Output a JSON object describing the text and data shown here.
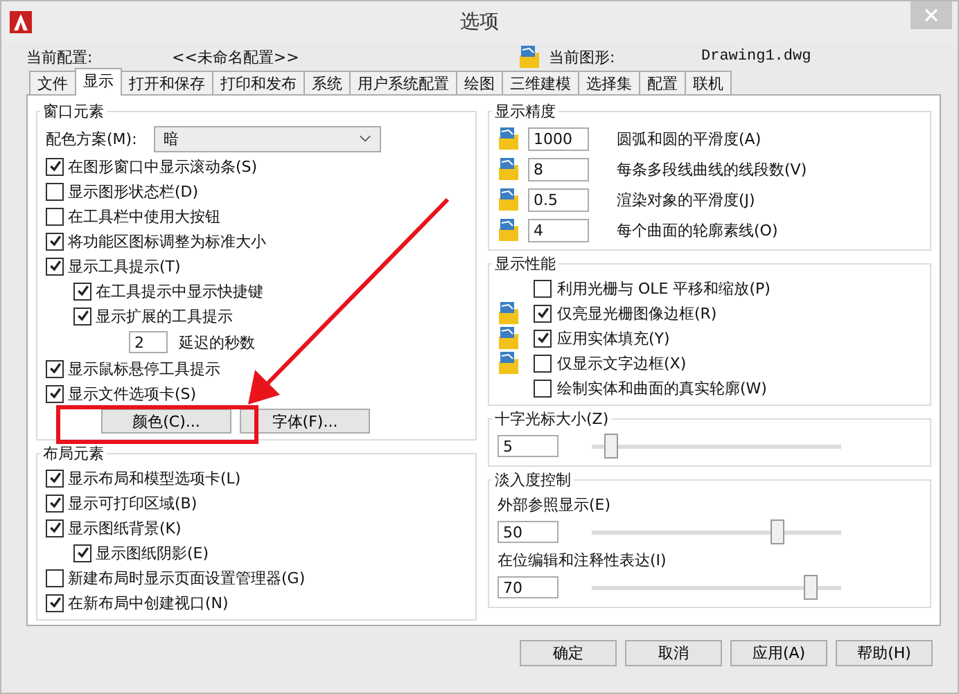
{
  "window": {
    "title": "选项"
  },
  "profile": {
    "label": "当前配置:",
    "value": "<<未命名配置>>",
    "drawing_label": "当前图形:",
    "drawing_value": "Drawing1.dwg"
  },
  "tabs": [
    {
      "label": "文件",
      "selected": false
    },
    {
      "label": "显示",
      "selected": true
    },
    {
      "label": "打开和保存",
      "selected": false
    },
    {
      "label": "打印和发布",
      "selected": false
    },
    {
      "label": "系统",
      "selected": false
    },
    {
      "label": "用户系统配置",
      "selected": false
    },
    {
      "label": "绘图",
      "selected": false
    },
    {
      "label": "三维建模",
      "selected": false
    },
    {
      "label": "选择集",
      "selected": false
    },
    {
      "label": "配置",
      "selected": false
    },
    {
      "label": "联机",
      "selected": false
    }
  ],
  "window_elements": {
    "title": "窗口元素",
    "color_scheme": {
      "label": "配色方案(M):",
      "value": "暗"
    },
    "items": [
      {
        "kind": "checkbox",
        "label": "在图形窗口中显示滚动条(S)",
        "checked": true
      },
      {
        "kind": "checkbox",
        "label": "显示图形状态栏(D)",
        "checked": false
      },
      {
        "kind": "checkbox",
        "label": "在工具栏中使用大按钮",
        "checked": false
      },
      {
        "kind": "checkbox",
        "label": "将功能区图标调整为标准大小",
        "checked": true
      },
      {
        "kind": "checkbox",
        "label": "显示工具提示(T)",
        "checked": true,
        "children": [
          {
            "kind": "checkbox",
            "label": "在工具提示中显示快捷键",
            "checked": true
          },
          {
            "kind": "checkbox",
            "label": "显示扩展的工具提示",
            "checked": true,
            "children": [
              {
                "kind": "number",
                "value": "2",
                "label": "延迟的秒数"
              }
            ]
          }
        ]
      },
      {
        "kind": "checkbox",
        "label": "显示鼠标悬停工具提示",
        "checked": true
      },
      {
        "kind": "checkbox",
        "label": "显示文件选项卡(S)",
        "checked": true
      }
    ],
    "buttons": [
      "颜色(C)...",
      "字体(F)..."
    ]
  },
  "layout_elements": {
    "title": "布局元素",
    "items": [
      {
        "kind": "checkbox",
        "label": "显示布局和模型选项卡(L)",
        "checked": true
      },
      {
        "kind": "checkbox",
        "label": "显示可打印区域(B)",
        "checked": true
      },
      {
        "kind": "checkbox",
        "label": "显示图纸背景(K)",
        "checked": true,
        "children": [
          {
            "kind": "checkbox",
            "label": "显示图纸阴影(E)",
            "checked": true
          }
        ]
      },
      {
        "kind": "checkbox",
        "label": "新建布局时显示页面设置管理器(G)",
        "checked": false
      },
      {
        "kind": "checkbox",
        "label": "在新布局中创建视口(N)",
        "checked": true
      }
    ]
  },
  "display_resolution": {
    "title": "显示精度",
    "rows": [
      {
        "value": "1000",
        "label": "圆弧和圆的平滑度(A)"
      },
      {
        "value": "8",
        "label": "每条多段线曲线的线段数(V)"
      },
      {
        "value": "0.5",
        "label": "渲染对象的平滑度(J)"
      },
      {
        "value": "4",
        "label": "每个曲面的轮廓素线(O)"
      }
    ]
  },
  "display_performance": {
    "title": "显示性能",
    "items": [
      {
        "label": "利用光栅与 OLE 平移和缩放(P)",
        "checked": false,
        "drawing_icon": false
      },
      {
        "label": "仅亮显光栅图像边框(R)",
        "checked": true,
        "drawing_icon": true
      },
      {
        "label": "应用实体填充(Y)",
        "checked": true,
        "drawing_icon": true
      },
      {
        "label": "仅显示文字边框(X)",
        "checked": false,
        "drawing_icon": true
      },
      {
        "label": "绘制实体和曲面的真实轮廓(W)",
        "checked": false,
        "drawing_icon": false
      }
    ]
  },
  "crosshair": {
    "title": "十字光标大小(Z)",
    "value": "5",
    "level": 0.05
  },
  "fade_control": {
    "title": "淡入度控制",
    "items": [
      {
        "label": "外部参照显示(E)",
        "value": "50",
        "level": 0.76
      },
      {
        "label": "在位编辑和注释性表达(I)",
        "value": "70",
        "level": 0.9
      }
    ]
  },
  "buttons": [
    "确定",
    "取消",
    "应用(A)",
    "帮助(H)"
  ]
}
